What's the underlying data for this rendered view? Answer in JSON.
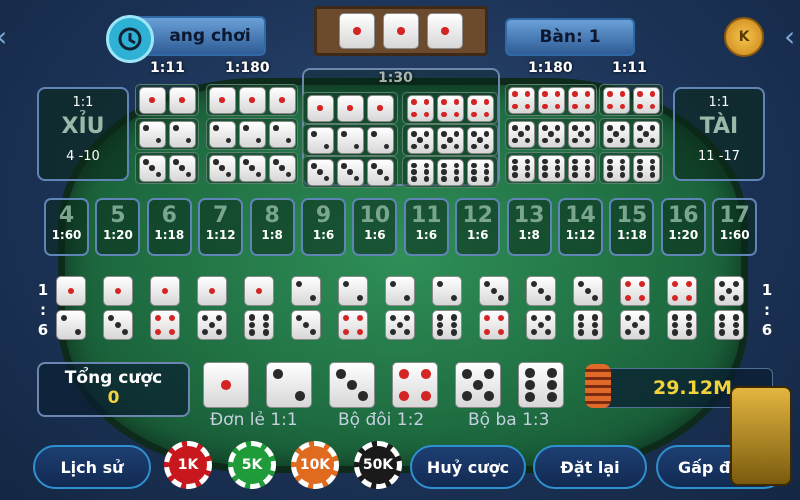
{
  "header": {
    "room_label": "ang chơi",
    "table_label": "Bàn: 1",
    "coin_letter": "K"
  },
  "top_odds": {
    "triple_left": "1:11",
    "triple_mid": "1:180",
    "any_triple": "1:30",
    "triple_right_mid": "1:180",
    "triple_right": "1:11"
  },
  "small": {
    "odds": "1:1",
    "label": "XỈU",
    "range": "4 -10"
  },
  "big": {
    "odds": "1:1",
    "label": "TÀI",
    "range": "11 -17"
  },
  "totals": [
    {
      "value": "4",
      "odds": "1:60"
    },
    {
      "value": "5",
      "odds": "1:20"
    },
    {
      "value": "6",
      "odds": "1:18"
    },
    {
      "value": "7",
      "odds": "1:12"
    },
    {
      "value": "8",
      "odds": "1:8"
    },
    {
      "value": "9",
      "odds": "1:6"
    },
    {
      "value": "10",
      "odds": "1:6"
    },
    {
      "value": "11",
      "odds": "1:6"
    },
    {
      "value": "12",
      "odds": "1:6"
    },
    {
      "value": "13",
      "odds": "1:8"
    },
    {
      "value": "14",
      "odds": "1:12"
    },
    {
      "value": "15",
      "odds": "1:18"
    },
    {
      "value": "16",
      "odds": "1:20"
    },
    {
      "value": "17",
      "odds": "1:60"
    }
  ],
  "combo_odds_left": [
    "1",
    ":",
    "6"
  ],
  "combo_odds_right": [
    "1",
    ":",
    "6"
  ],
  "bet_total": {
    "label": "Tổng cược",
    "value": "0"
  },
  "balance": "29.12M",
  "bet_types": {
    "single": "Đơn lẻ 1:1",
    "double": "Bộ đôi 1:2",
    "triple": "Bộ ba 1:3"
  },
  "chips": [
    {
      "label": "1K",
      "color": "#c8181e"
    },
    {
      "label": "5K",
      "color": "#1f9b3a"
    },
    {
      "label": "10K",
      "color": "#e06a1e"
    },
    {
      "label": "50K",
      "color": "#1a1a1a"
    }
  ],
  "buttons": {
    "history": "Lịch sử",
    "cancel": "Huỷ cược",
    "reset": "Đặt lại",
    "double": "Gấp đôi"
  }
}
